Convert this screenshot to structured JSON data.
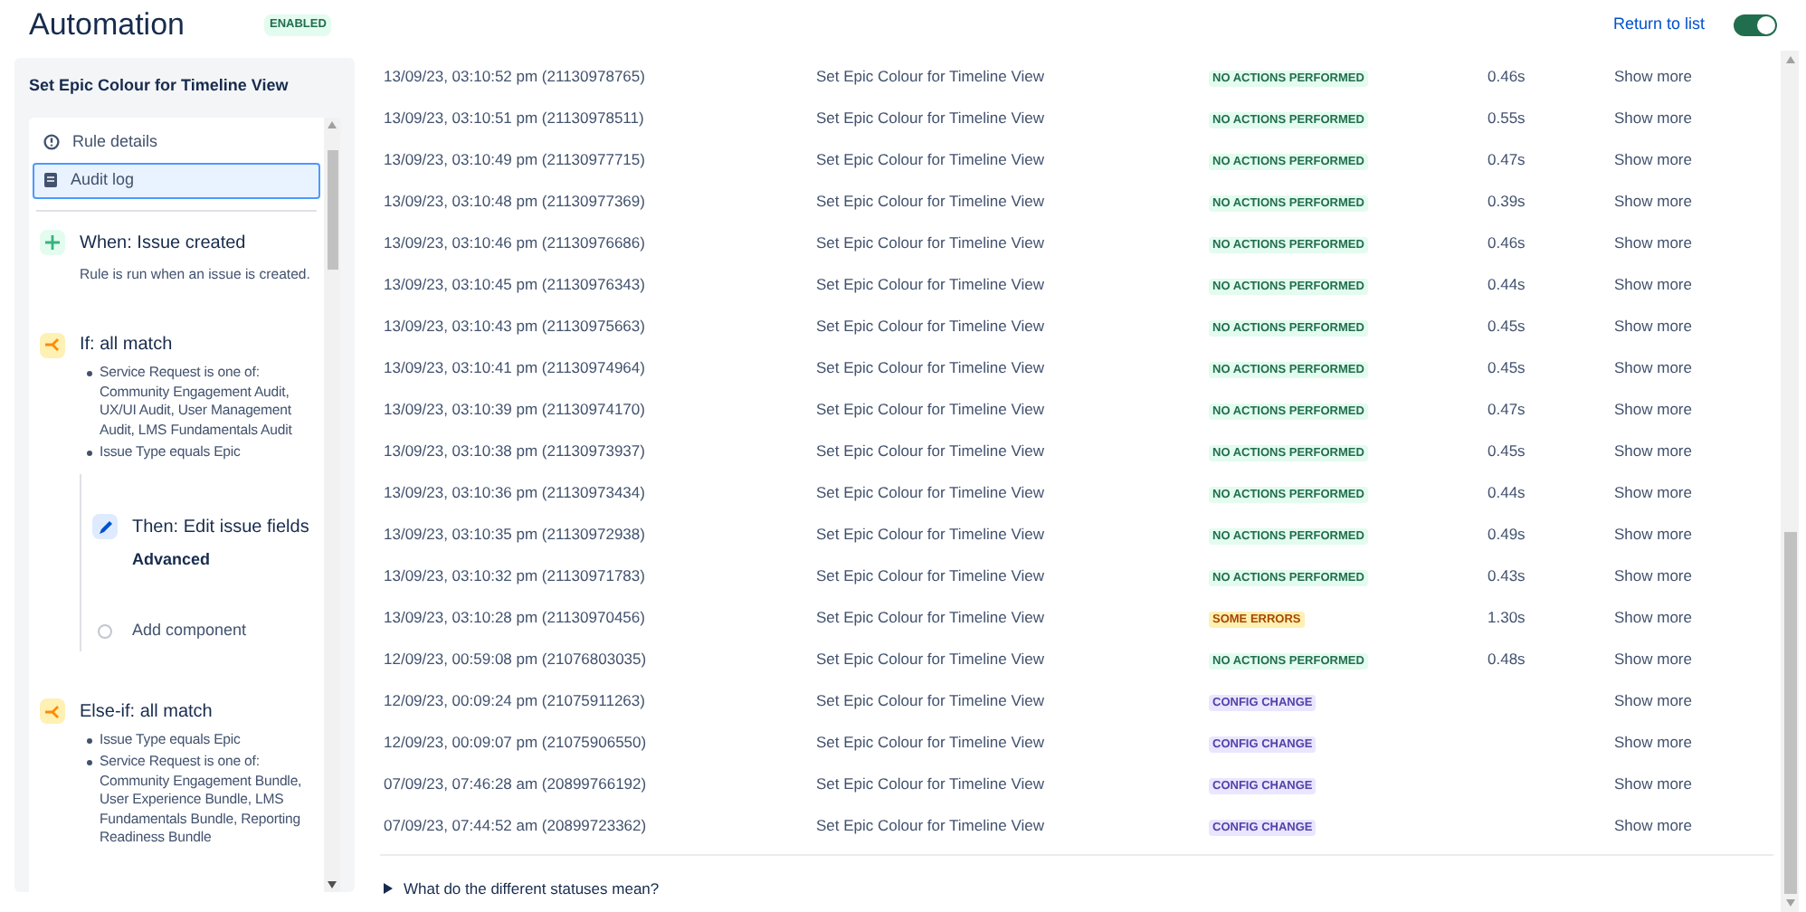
{
  "header": {
    "title": "Automation",
    "status_badge": "ENABLED",
    "return_link": "Return to list",
    "rule_enabled": true
  },
  "sidebar": {
    "title": "Set Epic Colour for Timeline View",
    "nav": [
      {
        "label": "Rule details",
        "kind": "info",
        "selected": false
      },
      {
        "label": "Audit log",
        "kind": "log",
        "selected": true
      }
    ],
    "steps": [
      {
        "kind": "trigger",
        "title": "When: Issue created",
        "description": "Rule is run when an issue is created."
      },
      {
        "kind": "condition",
        "title": "If: all match",
        "bullets": [
          "Service Request is one of: Community Engagement Audit, UX/UI Audit, User Management Audit, LMS Fundamentals Audit",
          "Issue Type equals Epic"
        ],
        "children": [
          {
            "kind": "action",
            "title": "Then: Edit issue fields",
            "detail": "Advanced"
          },
          {
            "kind": "add",
            "title": "Add component"
          }
        ]
      },
      {
        "kind": "condition",
        "title": "Else-if: all match",
        "bullets": [
          "Issue Type equals Epic",
          "Service Request is one of: Community Engagement Bundle, User Experience Bundle, LMS Fundamentals Bundle, Reporting Readiness Bundle"
        ]
      }
    ]
  },
  "table": {
    "rows": [
      {
        "date": "13/09/23, 03:10:52 pm (21130978765)",
        "rule": "Set Epic Colour for Timeline View",
        "status": "NO ACTIONS PERFORMED",
        "kind": "no_actions",
        "duration": "0.46s",
        "action": "Show more"
      },
      {
        "date": "13/09/23, 03:10:51 pm (21130978511)",
        "rule": "Set Epic Colour for Timeline View",
        "status": "NO ACTIONS PERFORMED",
        "kind": "no_actions",
        "duration": "0.55s",
        "action": "Show more"
      },
      {
        "date": "13/09/23, 03:10:49 pm (21130977715)",
        "rule": "Set Epic Colour for Timeline View",
        "status": "NO ACTIONS PERFORMED",
        "kind": "no_actions",
        "duration": "0.47s",
        "action": "Show more"
      },
      {
        "date": "13/09/23, 03:10:48 pm (21130977369)",
        "rule": "Set Epic Colour for Timeline View",
        "status": "NO ACTIONS PERFORMED",
        "kind": "no_actions",
        "duration": "0.39s",
        "action": "Show more"
      },
      {
        "date": "13/09/23, 03:10:46 pm (21130976686)",
        "rule": "Set Epic Colour for Timeline View",
        "status": "NO ACTIONS PERFORMED",
        "kind": "no_actions",
        "duration": "0.46s",
        "action": "Show more"
      },
      {
        "date": "13/09/23, 03:10:45 pm (21130976343)",
        "rule": "Set Epic Colour for Timeline View",
        "status": "NO ACTIONS PERFORMED",
        "kind": "no_actions",
        "duration": "0.44s",
        "action": "Show more"
      },
      {
        "date": "13/09/23, 03:10:43 pm (21130975663)",
        "rule": "Set Epic Colour for Timeline View",
        "status": "NO ACTIONS PERFORMED",
        "kind": "no_actions",
        "duration": "0.45s",
        "action": "Show more"
      },
      {
        "date": "13/09/23, 03:10:41 pm (21130974964)",
        "rule": "Set Epic Colour for Timeline View",
        "status": "NO ACTIONS PERFORMED",
        "kind": "no_actions",
        "duration": "0.45s",
        "action": "Show more"
      },
      {
        "date": "13/09/23, 03:10:39 pm (21130974170)",
        "rule": "Set Epic Colour for Timeline View",
        "status": "NO ACTIONS PERFORMED",
        "kind": "no_actions",
        "duration": "0.47s",
        "action": "Show more"
      },
      {
        "date": "13/09/23, 03:10:38 pm (21130973937)",
        "rule": "Set Epic Colour for Timeline View",
        "status": "NO ACTIONS PERFORMED",
        "kind": "no_actions",
        "duration": "0.45s",
        "action": "Show more"
      },
      {
        "date": "13/09/23, 03:10:36 pm (21130973434)",
        "rule": "Set Epic Colour for Timeline View",
        "status": "NO ACTIONS PERFORMED",
        "kind": "no_actions",
        "duration": "0.44s",
        "action": "Show more"
      },
      {
        "date": "13/09/23, 03:10:35 pm (21130972938)",
        "rule": "Set Epic Colour for Timeline View",
        "status": "NO ACTIONS PERFORMED",
        "kind": "no_actions",
        "duration": "0.49s",
        "action": "Show more"
      },
      {
        "date": "13/09/23, 03:10:32 pm (21130971783)",
        "rule": "Set Epic Colour for Timeline View",
        "status": "NO ACTIONS PERFORMED",
        "kind": "no_actions",
        "duration": "0.43s",
        "action": "Show more"
      },
      {
        "date": "13/09/23, 03:10:28 pm (21130970456)",
        "rule": "Set Epic Colour for Timeline View",
        "status": "SOME ERRORS",
        "kind": "some_errors",
        "duration": "1.30s",
        "action": "Show more"
      },
      {
        "date": "12/09/23, 00:59:08 pm (21076803035)",
        "rule": "Set Epic Colour for Timeline View",
        "status": "NO ACTIONS PERFORMED",
        "kind": "no_actions",
        "duration": "0.48s",
        "action": "Show more"
      },
      {
        "date": "12/09/23, 00:09:24 pm (21075911263)",
        "rule": "Set Epic Colour for Timeline View",
        "status": "CONFIG CHANGE",
        "kind": "config_change",
        "action": "Show more"
      },
      {
        "date": "12/09/23, 00:09:07 pm (21075906550)",
        "rule": "Set Epic Colour for Timeline View",
        "status": "CONFIG CHANGE",
        "kind": "config_change",
        "action": "Show more"
      },
      {
        "date": "07/09/23, 07:46:28 am (20899766192)",
        "rule": "Set Epic Colour for Timeline View",
        "status": "CONFIG CHANGE",
        "kind": "config_change",
        "action": "Show more"
      },
      {
        "date": "07/09/23, 07:44:52 am (20899723362)",
        "rule": "Set Epic Colour for Timeline View",
        "status": "CONFIG CHANGE",
        "kind": "config_change",
        "action": "Show more"
      }
    ]
  },
  "footer": {
    "expander": "What do the different statuses mean?",
    "expanded": false
  }
}
